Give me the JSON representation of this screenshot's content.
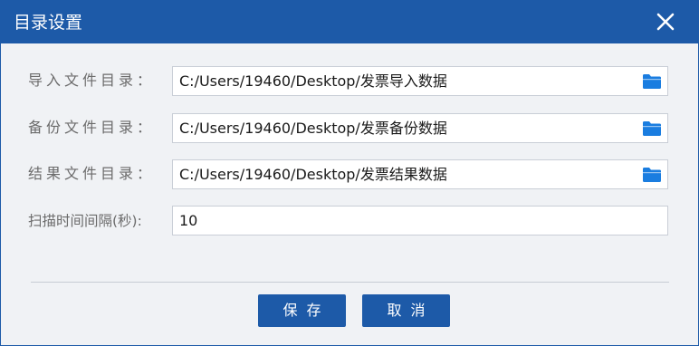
{
  "dialog": {
    "title": "目录设置"
  },
  "rows": [
    {
      "label": "导入文件目录：",
      "value": "C:/Users/19460/Desktop/发票导入数据"
    },
    {
      "label": "备份文件目录：",
      "value": "C:/Users/19460/Desktop/发票备份数据"
    },
    {
      "label": "结果文件目录：",
      "value": "C:/Users/19460/Desktop/发票结果数据"
    },
    {
      "label": "扫描时间间隔(秒):",
      "value": "10"
    }
  ],
  "buttons": {
    "save": "保存",
    "cancel": "取消"
  },
  "icons": {
    "close": "close-icon",
    "folder": "folder-icon"
  },
  "colors": {
    "accent": "#1d5aa8",
    "folder": "#1a7de0",
    "dialog_bg": "#f0f2f5"
  }
}
